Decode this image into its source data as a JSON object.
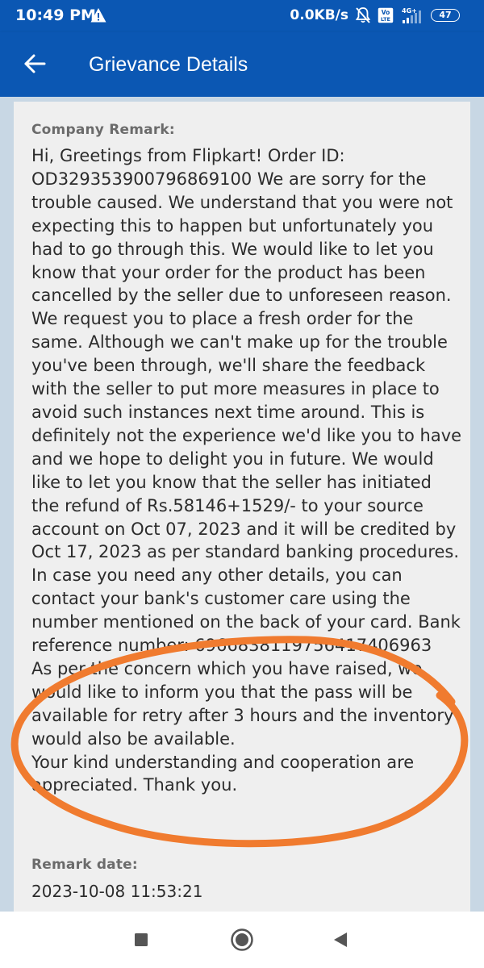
{
  "status_bar": {
    "time": "10:49 PM",
    "net_speed": "0.0KB/s",
    "volte_label": "Vo LTE",
    "network_type": "4G+",
    "battery_level": "47",
    "icons": [
      "warning-icon",
      "mute-icon",
      "volte-icon",
      "signal-icon",
      "battery-icon"
    ]
  },
  "app_bar": {
    "title": "Grievance Details",
    "back_icon": "back-arrow-icon"
  },
  "grievance": {
    "remark_label": "Company Remark:",
    "remark_text": "Hi, Greetings from Flipkart! Order ID: OD329353900796869100 We are sorry for the trouble caused. We understand that you were not expecting this to happen but unfortunately you had to go through this. We would like to let you know that your order for the product has been cancelled by the seller due to unforeseen reason. We request you to place a fresh order for the same. Although we can't make up for the trouble you've been through, we'll share the feedback with the seller to put more measures in place to avoid such instances next time around. This is definitely not the experience we'd like you to have and we hope to delight you in future. We would like to let you know that the seller has initiated the refund of Rs.58146+1529/- to your source account on Oct 07, 2023 and it will be credited by Oct 17, 2023 as per standard banking procedures. In case you need any other details, you can contact your bank's customer care using the number mentioned on the back of your card. Bank reference number: 6966838119756417406963\nAs per the concern which you have raised, we would like to inform you that the pass will be available for retry after 3 hours and the inventory would also be available.\nYour kind understanding and cooperation are appreciated. Thank you.",
    "date_label": "Remark date:",
    "date_value": "2023-10-08 11:53:21"
  },
  "annotation": {
    "color": "#f07b2f",
    "shape": "ellipse"
  },
  "colors": {
    "app_bar": "#0b57b3",
    "background": "#c8d7e4",
    "card": "#efefef"
  },
  "nav_bar": {
    "icons": [
      "recents-square-icon",
      "home-circle-icon",
      "back-triangle-icon"
    ]
  }
}
